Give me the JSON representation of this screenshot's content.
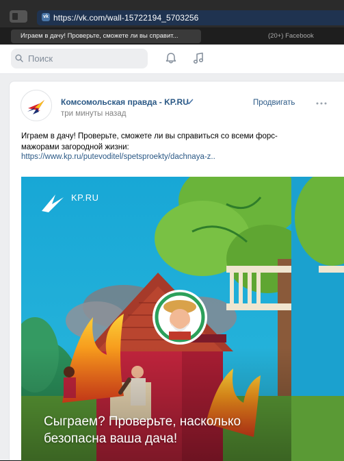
{
  "browser": {
    "url": "https://vk.com/wall-15722194_5703256",
    "tabs": [
      {
        "label": "Играем в дачу! Проверьте, сможете ли вы справит...",
        "active": true
      },
      {
        "label": "(20+) Facebook",
        "active": false
      }
    ]
  },
  "header": {
    "search_placeholder": "Поиск",
    "icons": [
      "search-icon",
      "bell-icon",
      "music-icon"
    ]
  },
  "post": {
    "author": "Комсомольская правда - KP.RU",
    "time": "три минуты назад",
    "promote_label": "Продвигать",
    "text": "Играем в дачу! Проверьте, сможете ли вы справиться со всеми форс-мажорами загородной жизни:",
    "link": "https://www.kp.ru/putevoditel/spetsproekty/dachnaya-z..",
    "image": {
      "brand_label": "KP.RU",
      "title": "Сыграем? Проверьте, насколько безопасна ваша дача!"
    }
  },
  "colors": {
    "vk_link": "#2a5885",
    "sky": "#1ba1cf",
    "roof": "#a63a2a",
    "house_red": "#c0243c",
    "tree_green": "#6ab43a"
  }
}
